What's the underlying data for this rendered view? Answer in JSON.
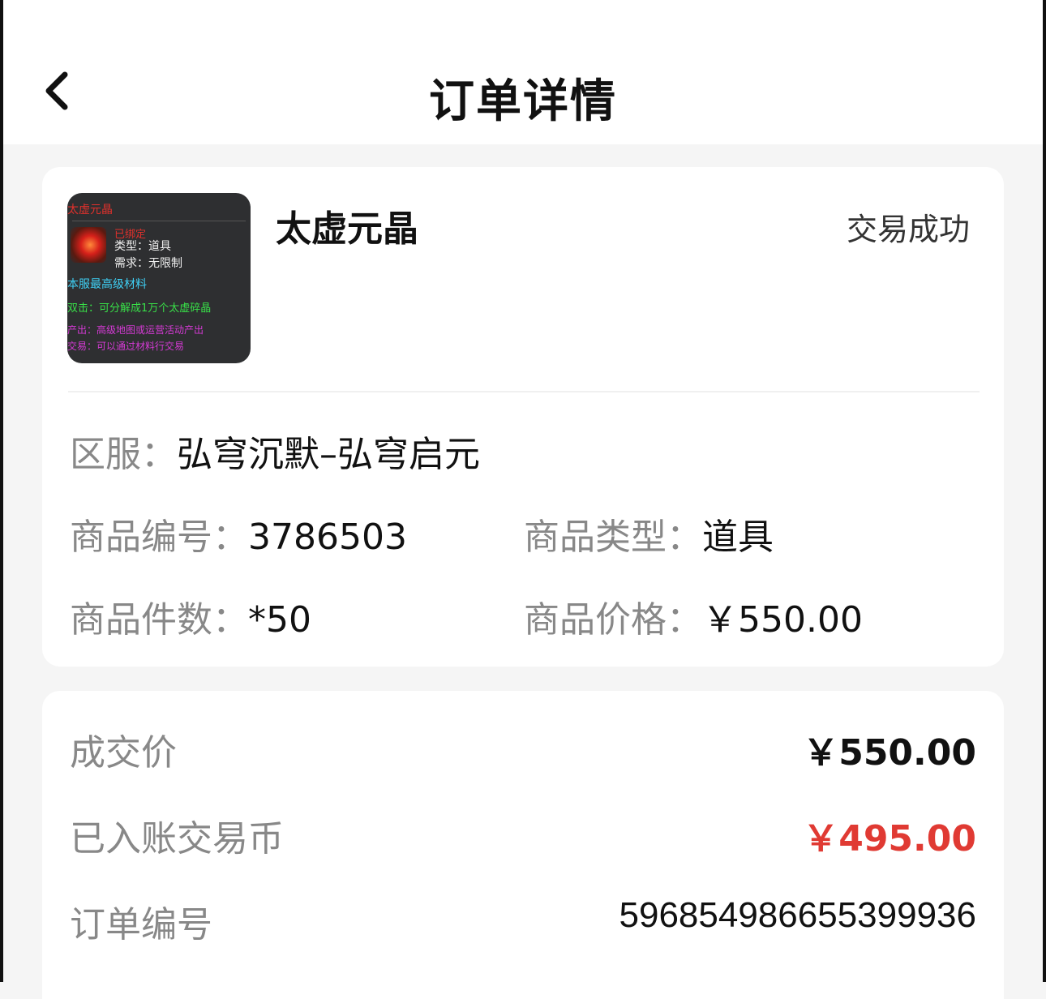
{
  "header": {
    "title": "订单详情",
    "back_icon": "chevron-left-icon"
  },
  "product": {
    "name": "太虚元晶",
    "status": "交易成功",
    "thumbnail": {
      "title": "太虚元晶",
      "bind": "已绑定",
      "type_line": "类型：道具",
      "requirement_line": "需求：无限制",
      "desc_line": "本服最高级材料",
      "use_line": "双击：可分解成1万个太虚碎晶",
      "source_line": "产出：高级地图或运营活动产出",
      "trade_line": "交易：可以通过材料行交易"
    },
    "server_label": "区服：",
    "server_value": "弘穹沉默–弘穹启元",
    "id_label": "商品编号：",
    "id_value": "3786503",
    "type_label": "商品类型：",
    "type_value": "道具",
    "count_label": "商品件数：",
    "count_value": "*50",
    "price_label": "商品价格：",
    "price_value": "￥550.00"
  },
  "summary": {
    "deal_label": "成交价",
    "deal_value": "￥550.00",
    "credited_label": "已入账交易币",
    "credited_value": "￥495.00",
    "order_label": "订单编号",
    "order_value": "596854986655399936"
  },
  "colors": {
    "accent_red": "#e03a33",
    "label_gray": "#888888",
    "background": "#f5f5f5"
  }
}
